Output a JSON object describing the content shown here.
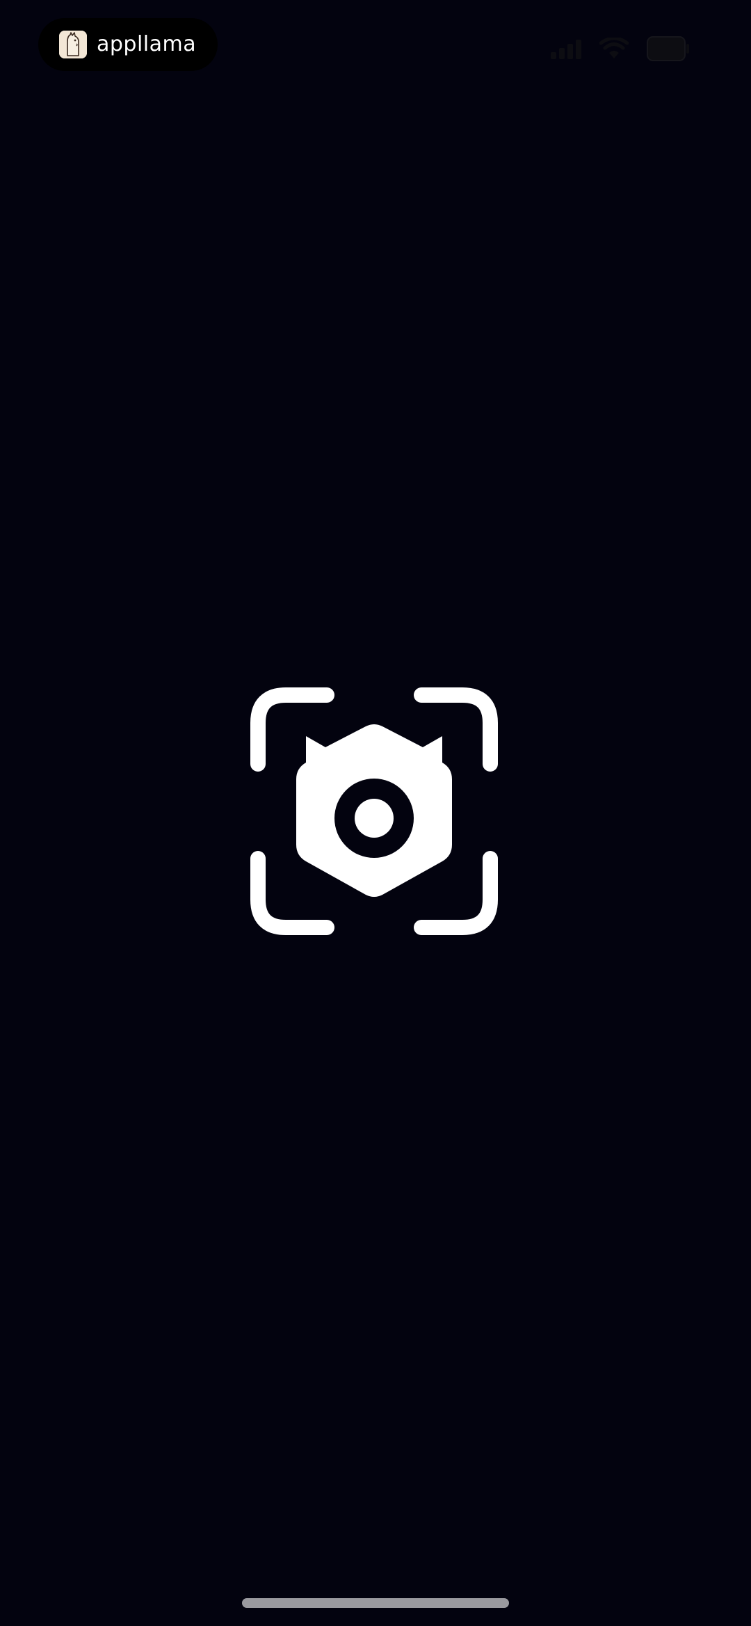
{
  "status_bar": {
    "app_name": "appllama",
    "icons": [
      "cellular-signal-icon",
      "wifi-icon",
      "battery-icon"
    ]
  },
  "main": {
    "icon": "camera-scan-icon"
  },
  "colors": {
    "background": "#03030f",
    "icon": "#ffffff",
    "home_indicator": "#9a9a9f"
  }
}
